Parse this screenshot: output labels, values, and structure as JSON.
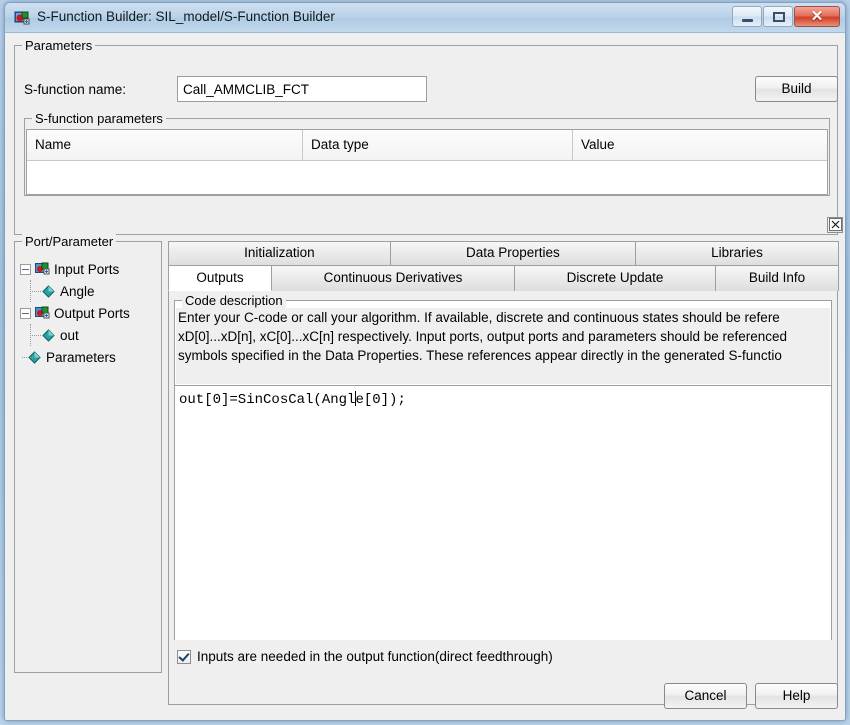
{
  "window": {
    "title": "S-Function Builder: SIL_model/S-Function Builder",
    "icon": "simulink-block-icon",
    "controls": {
      "minimize": "—",
      "maximize": "□",
      "close": "✕"
    }
  },
  "parameters": {
    "legend": "Parameters",
    "sfunction_name_label": "S-function name:",
    "sfunction_name_value": "Call_AMMCLIB_FCT",
    "sfunction_name_placeholder": "",
    "build_label": "Build",
    "sfp_legend": "S-function parameters",
    "table": {
      "columns": [
        "Name",
        "Data type",
        "Value"
      ],
      "rows": []
    },
    "collapse_label": "☒"
  },
  "port_tree": {
    "legend": "Port/Parameter",
    "nodes": [
      {
        "label": "Input Ports",
        "icon": "port-icon",
        "expanded": true
      },
      {
        "label": "Angle",
        "icon": "diamond-icon"
      },
      {
        "label": "Output Ports",
        "icon": "port-icon",
        "expanded": true
      },
      {
        "label": "out",
        "icon": "diamond-icon"
      },
      {
        "label": "Parameters",
        "icon": "diamond-icon"
      }
    ]
  },
  "tabs": {
    "row1": [
      {
        "label": "Initialization",
        "active": false
      },
      {
        "label": "Data Properties",
        "active": false
      },
      {
        "label": "Libraries",
        "active": false
      }
    ],
    "row2": [
      {
        "label": "Outputs",
        "active": true
      },
      {
        "label": "Continuous Derivatives",
        "active": false
      },
      {
        "label": "Discrete Update",
        "active": false
      },
      {
        "label": "Build Info",
        "active": false
      }
    ]
  },
  "outputs_panel": {
    "code_description_legend": "Code description",
    "description_lines": [
      "Enter your C-code or call your algorithm. If available, discrete and continuous states should be refere",
      "xD[0]...xD[n], xC[0]...xC[n] respectively. Input ports, output ports and parameters should be referenced",
      "symbols specified in the Data Properties. These references appear directly in the generated S-functio"
    ],
    "code_before_caret": "out[0]=SinCosCal(Angl",
    "code_after_caret": "e[0]);",
    "direct_feedthrough_label": "Inputs are needed in the output function(direct feedthrough)",
    "direct_feedthrough_checked": true
  },
  "footer": {
    "cancel_label": "Cancel",
    "help_label": "Help"
  },
  "colors": {
    "titlebar": "#b4cfe7",
    "dialog_bg": "#efefef",
    "close_button": "#cf3f27",
    "tree_leaf_icon": "#1f8c8c"
  }
}
